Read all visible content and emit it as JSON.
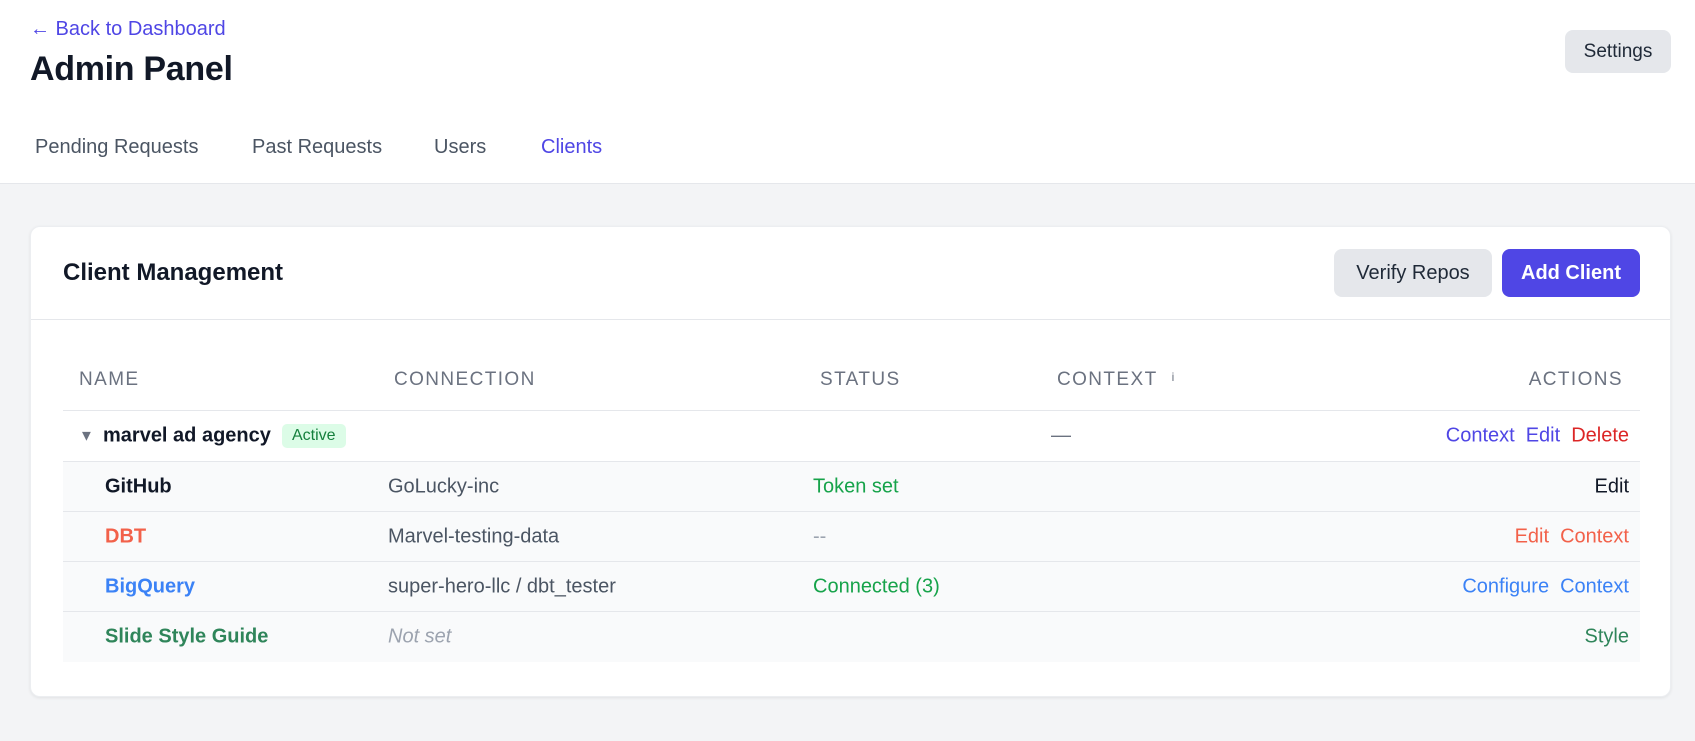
{
  "header": {
    "back_link": "← Back to Dashboard",
    "title": "Admin Panel",
    "settings_label": "Settings"
  },
  "tabs": [
    {
      "label": "Pending Requests",
      "active": false
    },
    {
      "label": "Past Requests",
      "active": false
    },
    {
      "label": "Users",
      "active": false
    },
    {
      "label": "Clients",
      "active": true
    }
  ],
  "card": {
    "title": "Client Management",
    "verify_label": "Verify Repos",
    "add_label": "Add Client"
  },
  "table": {
    "columns": {
      "name": "NAME",
      "connection": "CONNECTION",
      "status": "STATUS",
      "context": "CONTEXT",
      "context_info": "i",
      "actions": "ACTIONS"
    },
    "client": {
      "name": "marvel ad agency",
      "badge": "Active",
      "context": "—",
      "actions": {
        "context": "Context",
        "edit": "Edit",
        "delete": "Delete"
      }
    },
    "rows": [
      {
        "name": "GitHub",
        "connection": "GoLucky-inc",
        "status": "Token set",
        "actions": [
          "Edit"
        ]
      },
      {
        "name": "DBT",
        "connection": "Marvel-testing-data",
        "status": "--",
        "actions": [
          "Edit",
          "Context"
        ]
      },
      {
        "name": "BigQuery",
        "connection": "super-hero-llc / dbt_tester",
        "status": "Connected (3)",
        "actions": [
          "Configure",
          "Context"
        ]
      },
      {
        "name": "Slide Style Guide",
        "connection": "Not set",
        "status": "",
        "actions": [
          "Style"
        ]
      }
    ]
  },
  "colors": {
    "accent": "#4f46e5",
    "danger": "#dc2626",
    "success": "#16a34a",
    "dbt": "#f2614a",
    "bigquery": "#3b82f6",
    "slides": "#2f855a"
  }
}
